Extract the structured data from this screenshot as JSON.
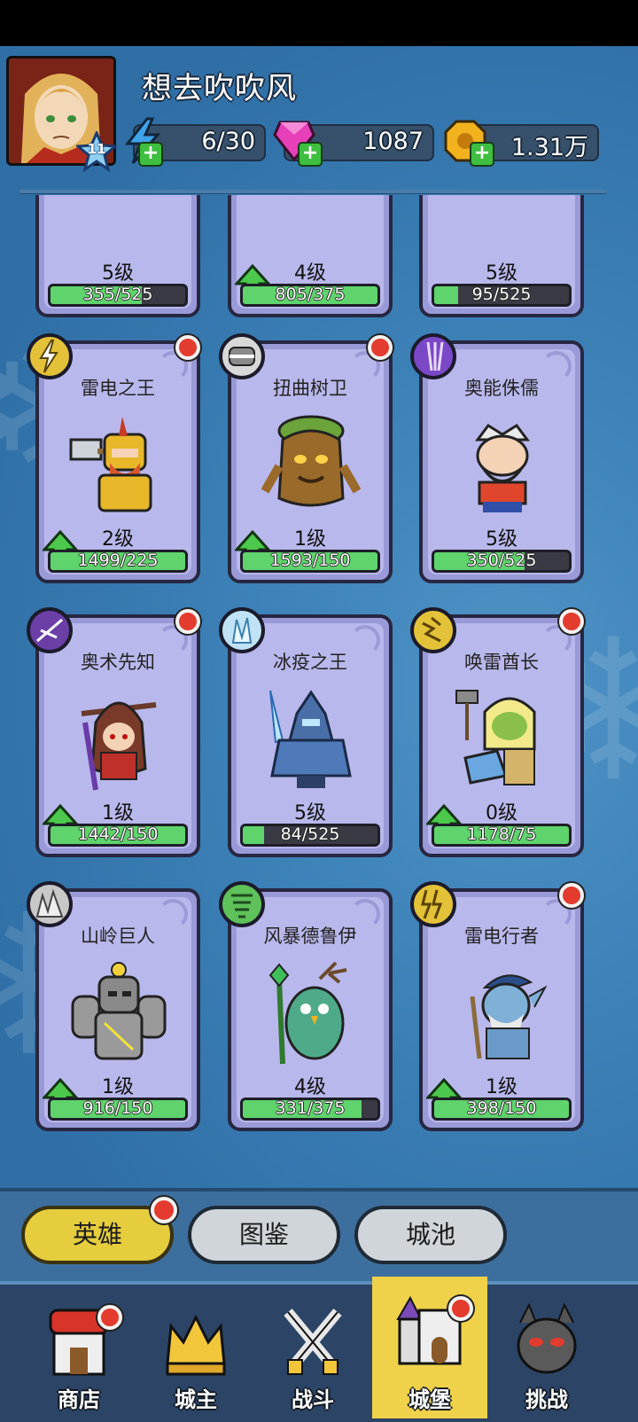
{
  "player": {
    "name": "想去吹吹风",
    "level": "11"
  },
  "resources": {
    "energy": "6/30",
    "gems": "1087",
    "gold": "1.31万"
  },
  "partial_row": [
    {
      "level": "5级",
      "progress": "355/525",
      "fill": 0.68,
      "upgrade": false
    },
    {
      "level": "4级",
      "progress": "805/375",
      "fill": 1.0,
      "upgrade": true
    },
    {
      "level": "5级",
      "progress": "95/525",
      "fill": 0.18,
      "upgrade": false
    }
  ],
  "heroes": [
    {
      "name": "雷电之王",
      "level": "2级",
      "progress": "1499/225",
      "fill": 1.0,
      "upgrade": true,
      "red_dot": true,
      "type_icon": "lightning-icon",
      "type_color": "#e3c23a"
    },
    {
      "name": "扭曲树卫",
      "level": "1级",
      "progress": "1593/150",
      "fill": 1.0,
      "upgrade": true,
      "red_dot": true,
      "type_icon": "shield-icon",
      "type_color": "#d8d8d8"
    },
    {
      "name": "奥能侏儒",
      "level": "5级",
      "progress": "350/525",
      "fill": 0.67,
      "upgrade": false,
      "red_dot": false,
      "type_icon": "arcane-icon",
      "type_color": "#7b48c7"
    },
    {
      "name": "奥术先知",
      "level": "1级",
      "progress": "1442/150",
      "fill": 1.0,
      "upgrade": true,
      "red_dot": true,
      "type_icon": "arrows-icon",
      "type_color": "#6b3fa6"
    },
    {
      "name": "冰疫之王",
      "level": "5级",
      "progress": "84/525",
      "fill": 0.16,
      "upgrade": false,
      "red_dot": false,
      "type_icon": "ice-icon",
      "type_color": "#bfe3f5"
    },
    {
      "name": "唤雷酋长",
      "level": "0级",
      "progress": "1178/75",
      "fill": 1.0,
      "upgrade": true,
      "red_dot": true,
      "type_icon": "thunder-icon",
      "type_color": "#e3c23a"
    },
    {
      "name": "山岭巨人",
      "level": "1级",
      "progress": "916/150",
      "fill": 1.0,
      "upgrade": true,
      "red_dot": false,
      "type_icon": "rock-icon",
      "type_color": "#c8c8c8"
    },
    {
      "name": "风暴德鲁伊",
      "level": "4级",
      "progress": "331/375",
      "fill": 0.88,
      "upgrade": false,
      "red_dot": false,
      "type_icon": "wind-icon",
      "type_color": "#5ec15a"
    },
    {
      "name": "雷电行者",
      "level": "1级",
      "progress": "398/150",
      "fill": 1.0,
      "upgrade": true,
      "red_dot": true,
      "type_icon": "bolt-icon",
      "type_color": "#e3c23a"
    }
  ],
  "tabs": [
    {
      "label": "英雄",
      "active": true,
      "dot": true
    },
    {
      "label": "图鉴",
      "active": false,
      "dot": false
    },
    {
      "label": "城池",
      "active": false,
      "dot": false
    }
  ],
  "nav": [
    {
      "label": "商店",
      "icon": "shop-icon",
      "dot": true
    },
    {
      "label": "城主",
      "icon": "crown-icon",
      "dot": false
    },
    {
      "label": "战斗",
      "icon": "swords-icon",
      "dot": false
    },
    {
      "label": "城堡",
      "icon": "castle-icon",
      "dot": true,
      "active": true
    },
    {
      "label": "挑战",
      "icon": "demon-icon",
      "dot": false
    }
  ]
}
